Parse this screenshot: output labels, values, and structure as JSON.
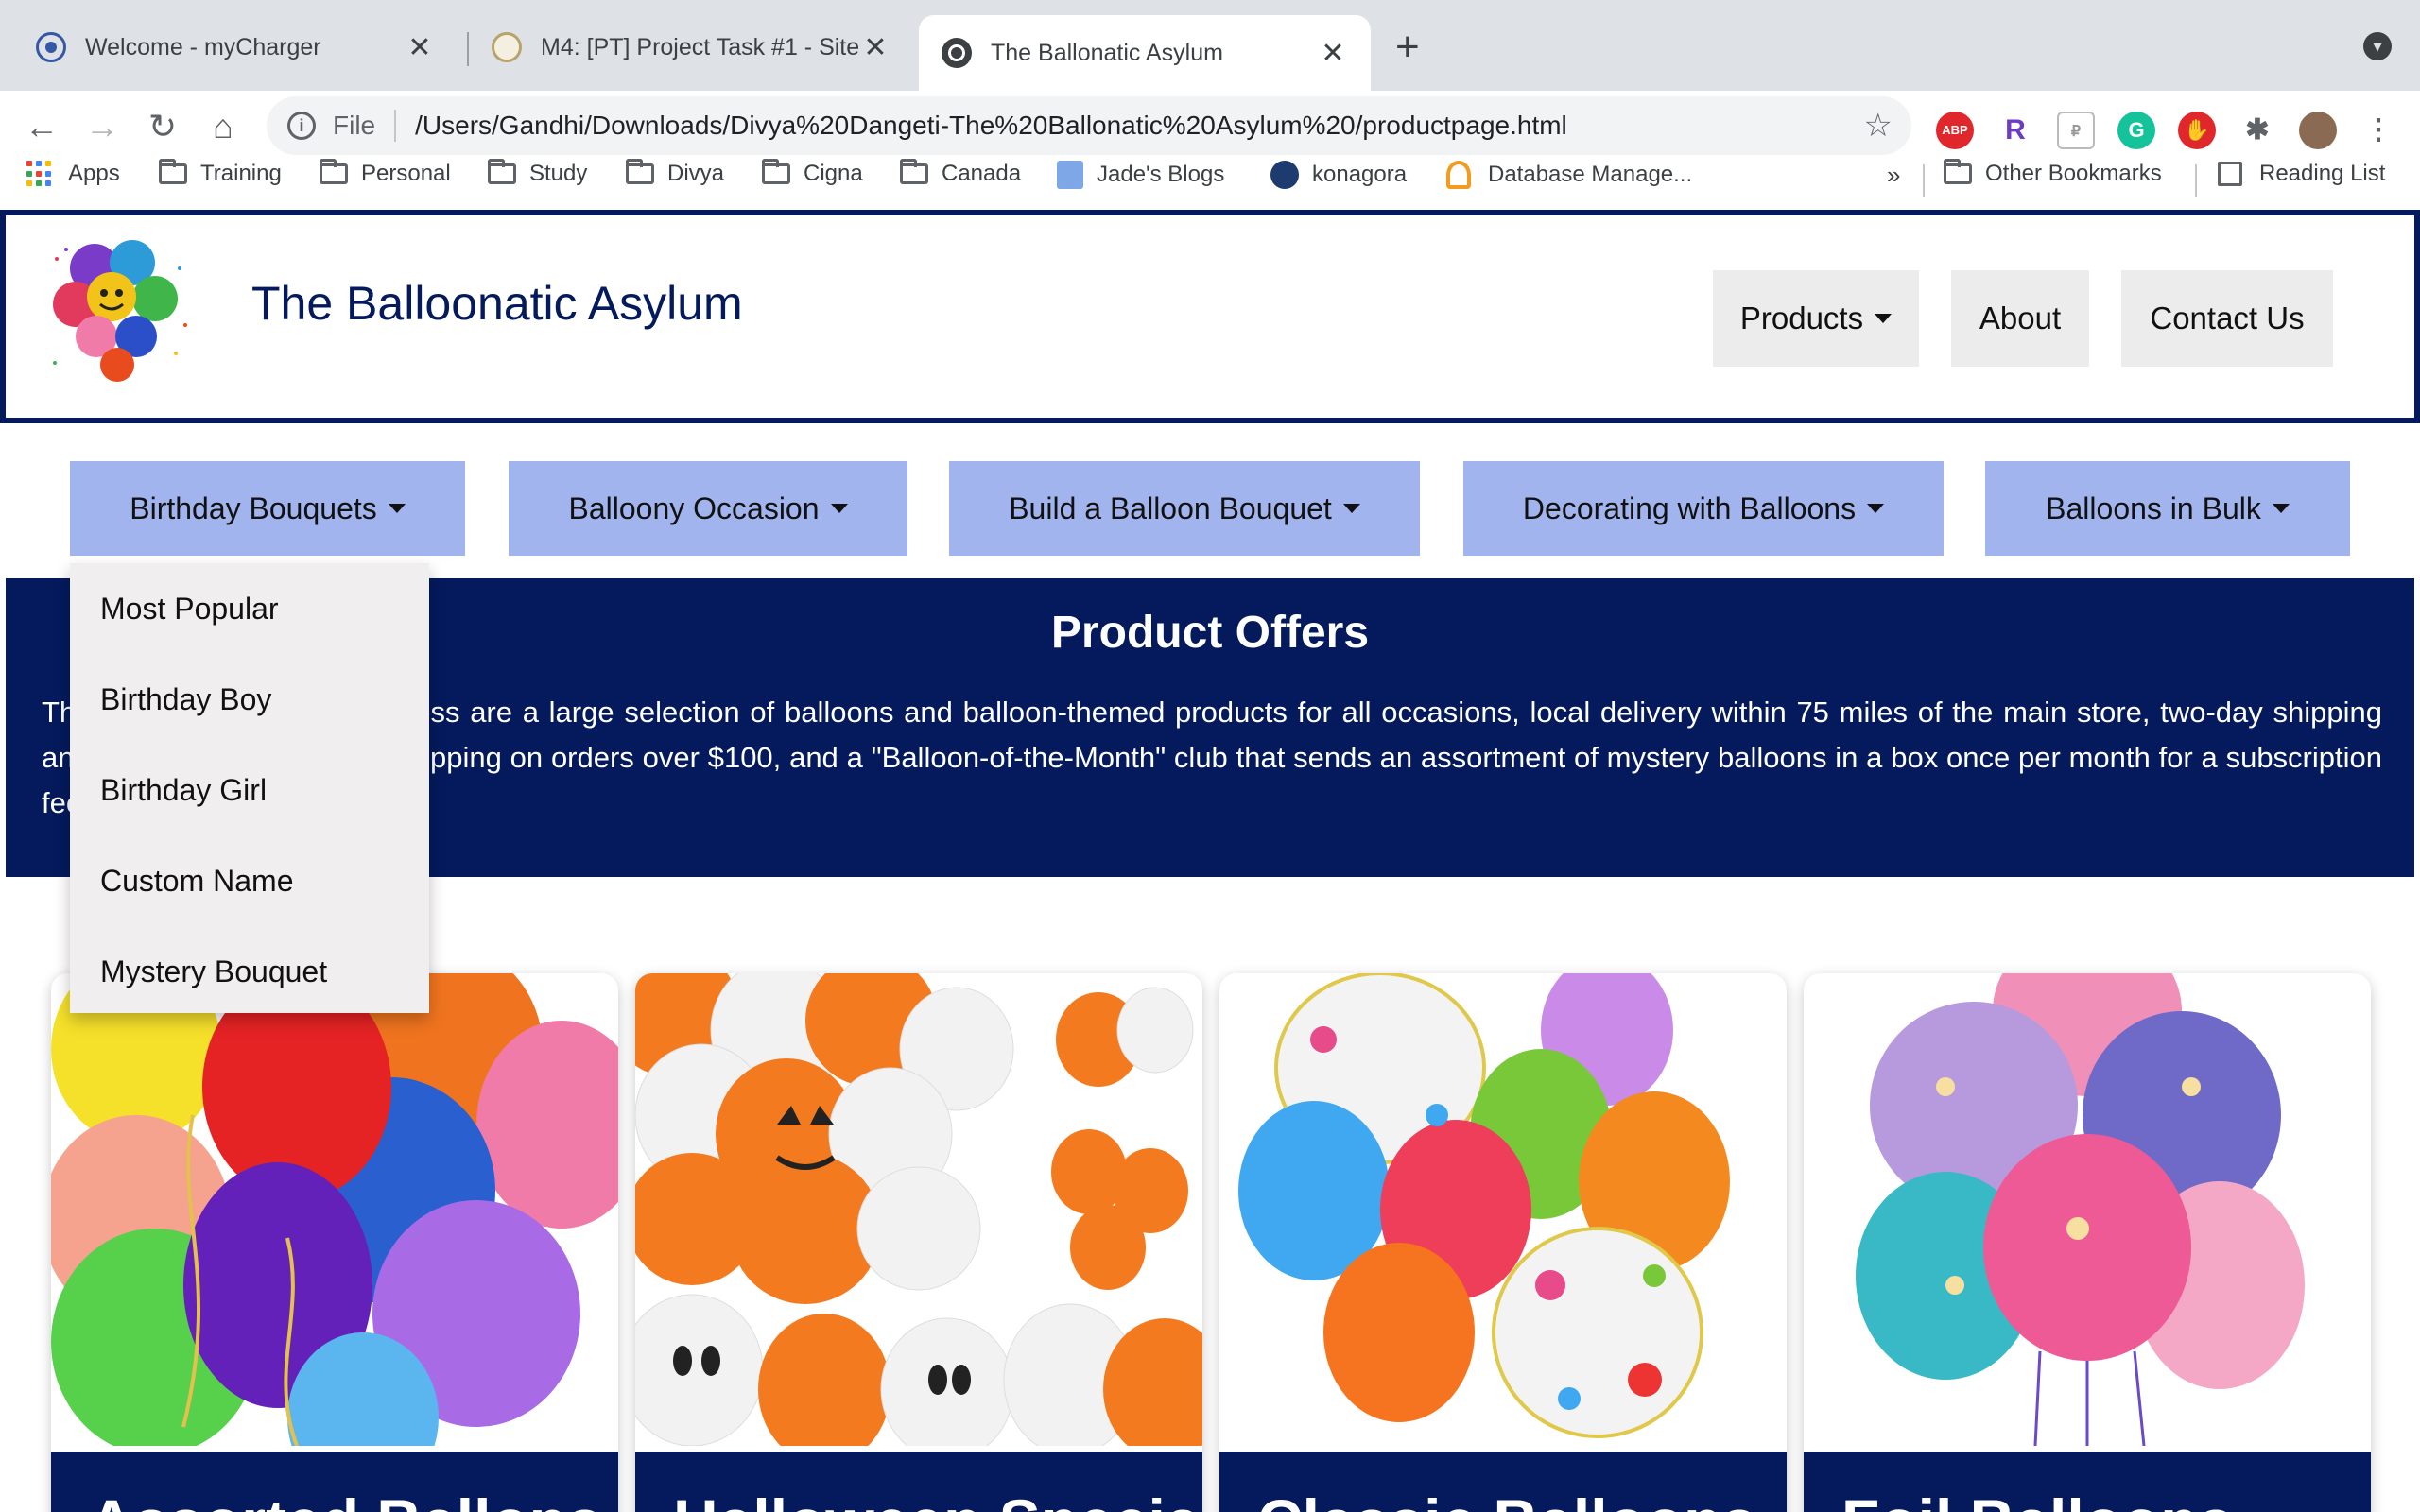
{
  "browser": {
    "tabs": [
      {
        "title": "Welcome - myCharger",
        "icon": "mycharger-favicon-icon"
      },
      {
        "title": "M4: [PT] Project Task #1 - Site",
        "icon": "course-favicon-icon"
      },
      {
        "title": "The Ballonatic Asylum",
        "icon": "globe-icon"
      }
    ],
    "address_scheme": "File",
    "address_url": "/Users/Gandhi/Downloads/Divya%20Dangeti-The%20Ballonatic%20Asylum%20/productpage.html",
    "bookmarks": [
      "Apps",
      "Training",
      "Personal",
      "Study",
      "Divya",
      "Cigna",
      "Canada",
      "Jade's Blogs",
      "konagora",
      "Database Manage...",
      "Other Bookmarks",
      "Reading List"
    ],
    "bookmarks_overflow": "»"
  },
  "site": {
    "title": "The Balloonatic Asylum",
    "top_nav": [
      "Products",
      "About",
      "Contact Us"
    ],
    "sub_nav": [
      "Birthday Bouquets",
      "Balloony Occasion",
      "Build a Balloon Bouquet",
      "Decorating with Balloons",
      "Balloons in Bulk"
    ],
    "dropdown": [
      "Most Popular",
      "Birthday Boy",
      "Birthday Girl",
      "Custom Name",
      "Mystery Bouquet"
    ],
    "offers": {
      "heading": "Product Offers",
      "text": "The main offers of the business are a large selection of balloons and balloon-themed products for all occasions, local delivery within 75 miles of the main store, two-day shipping anywhere in the USA, free shipping on orders over $100, and a \"Balloon-of-the-Month\" club that sends an assortment of mystery balloons in a box once per month for a subscription fee."
    },
    "cards": [
      {
        "title": "Assorted Ballons"
      },
      {
        "title": "Halloween Special"
      },
      {
        "title": "Classic Balloons"
      },
      {
        "title": "Foil Balloons"
      }
    ]
  },
  "colors": {
    "brand_navy": "#041a5c",
    "subnav_blue": "#a1b4ee"
  }
}
